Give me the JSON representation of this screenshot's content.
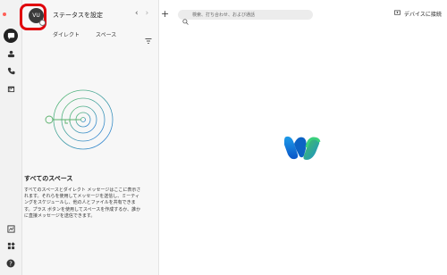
{
  "header": {
    "status_placeholder": "ステータスを設定",
    "avatar_initials": "VU",
    "nav_back": "‹",
    "nav_forward": "›",
    "new_label": "+",
    "search_placeholder": "検索、打ち合わせ、および通話",
    "device_label": "デバイスに接続"
  },
  "tabs": [
    {
      "label": "ダイレクト"
    },
    {
      "label": "スペース"
    }
  ],
  "rail": {
    "items": [
      "messaging-icon",
      "teams-icon",
      "calls-icon",
      "calendar-icon"
    ],
    "bottom": [
      "whiteboard-icon",
      "apps-icon",
      "help-icon"
    ]
  },
  "empty_state": {
    "title": "すべてのスペース",
    "description": "すべてのスペースとダイレクト メッセージはここに表示されます。それらを使用してメッセージを送信し、ミーティングをスケジュールし、他の人とファイルを共有できます。プラス ボタンを使用してスペースを作成するか、誰かに直接メッセージを送信できます。"
  },
  "colors": {
    "highlight": "#e0000b",
    "accent_green": "#5bbf6a",
    "accent_blue": "#2f7fe0"
  }
}
